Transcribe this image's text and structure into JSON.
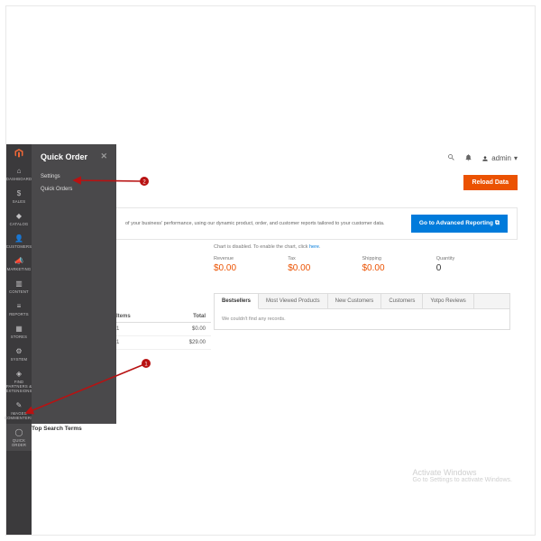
{
  "iconbar": [
    {
      "label": "DASHBOARD",
      "icon": "⌂"
    },
    {
      "label": "SALES",
      "icon": "$"
    },
    {
      "label": "CATALOG",
      "icon": "◆"
    },
    {
      "label": "CUSTOMERS",
      "icon": "👤"
    },
    {
      "label": "MARKETING",
      "icon": "📣"
    },
    {
      "label": "CONTENT",
      "icon": "▥"
    },
    {
      "label": "REPORTS",
      "icon": "≡"
    },
    {
      "label": "STORES",
      "icon": "▦"
    },
    {
      "label": "SYSTEM",
      "icon": "⚙"
    },
    {
      "label": "FIND PARTNERS & EXTENSIONS",
      "icon": "◈"
    },
    {
      "label": "IMAGES COMMENTERS",
      "icon": "✎"
    },
    {
      "label": "QUICK ORDER",
      "icon": "◯",
      "active": true
    }
  ],
  "flyout": {
    "title": "Quick Order",
    "items": [
      "Settings",
      "Quick Orders"
    ]
  },
  "user": "admin",
  "reload_btn": "Reload Data",
  "advisor": {
    "text": "of your business' performance, using our dynamic product, order, and customer reports tailored to your customer data.",
    "cta": "Go to Advanced Reporting"
  },
  "chart_note": {
    "pre": "Chart is disabled. To enable the chart, click ",
    "link": "here"
  },
  "stats": [
    {
      "label": "Revenue",
      "value": "$0.00",
      "orange": true
    },
    {
      "label": "Tax",
      "value": "$0.00",
      "orange": true
    },
    {
      "label": "Shipping",
      "value": "$0.00",
      "orange": true
    },
    {
      "label": "Quantity",
      "value": "0",
      "orange": false
    }
  ],
  "table": {
    "cols": [
      "Items",
      "Total"
    ],
    "rows": [
      [
        "1",
        "$0.00"
      ],
      [
        "1",
        "$29.00"
      ]
    ]
  },
  "tabs": {
    "items": [
      "Bestsellers",
      "Most Viewed Products",
      "New Customers",
      "Customers",
      "Yotpo Reviews"
    ],
    "active": 0,
    "empty": "We couldn't find any records."
  },
  "watermark": {
    "l1": "Activate Windows",
    "l2": "Go to Settings to activate Windows."
  },
  "top_search": "Top Search Terms",
  "annot": {
    "n1": "1",
    "n2": "2"
  }
}
